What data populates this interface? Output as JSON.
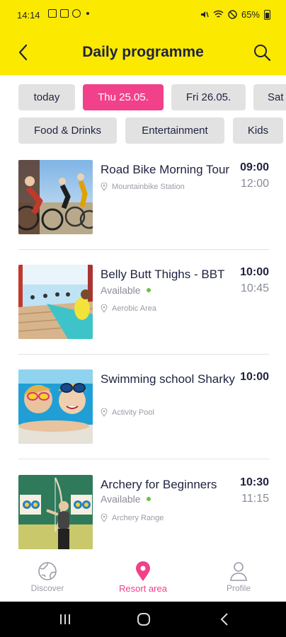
{
  "status_bar": {
    "time": "14:14",
    "battery": "65%"
  },
  "header": {
    "title": "Daily programme"
  },
  "date_tabs": [
    {
      "label": "today",
      "active": false
    },
    {
      "label": "Thu 25.05.",
      "active": true
    },
    {
      "label": "Fri 26.05.",
      "active": false
    },
    {
      "label": "Sat",
      "active": false
    }
  ],
  "category_tabs": [
    {
      "label": "Food & Drinks"
    },
    {
      "label": "Entertainment"
    },
    {
      "label": "Kids"
    }
  ],
  "events": [
    {
      "title": "Road Bike Morning Tour",
      "start": "09:00",
      "end": "12:00",
      "availability": "",
      "location": "Mountainbike Station",
      "image": "cyclists"
    },
    {
      "title": "Belly Butt Thighs - BBT",
      "start": "10:00",
      "end": "10:45",
      "availability": "Available",
      "location": "Aerobic Area",
      "image": "aerobics"
    },
    {
      "title": "Swimming school Sharky",
      "start": "10:00",
      "end": "",
      "availability": "",
      "location": "Activity Pool",
      "image": "swimming-kids"
    },
    {
      "title": "Archery for Beginners",
      "start": "10:30",
      "end": "11:15",
      "availability": "Available",
      "location": "Archery Range",
      "image": "archery"
    }
  ],
  "bottom_nav": [
    {
      "label": "Discover",
      "icon": "globe-icon",
      "active": false
    },
    {
      "label": "Resort area",
      "icon": "map-pin-icon",
      "active": true
    },
    {
      "label": "Profile",
      "icon": "person-icon",
      "active": false
    }
  ],
  "colors": {
    "header_bg": "#fbe900",
    "accent": "#f0418a",
    "available": "#6bc33a",
    "text": "#1f2240"
  }
}
